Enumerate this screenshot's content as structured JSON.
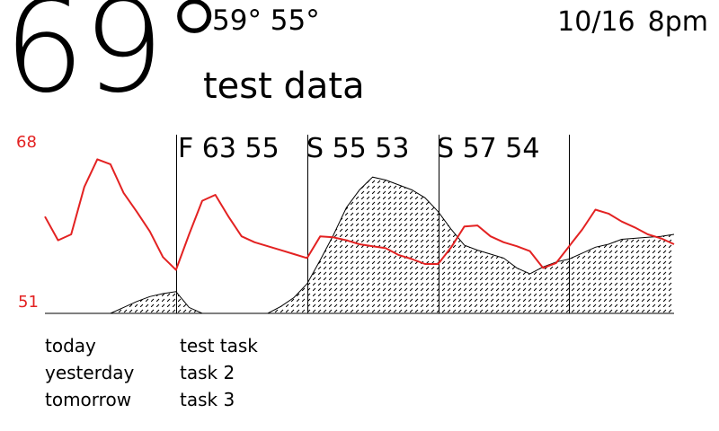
{
  "header": {
    "current_temp": "69°",
    "high_low": "59° 55°",
    "condition": "test data",
    "date": "10/16",
    "time": "8pm"
  },
  "chart_data": {
    "type": "line",
    "y_axis_labels": {
      "max": "68",
      "min": "51"
    },
    "ylim": [
      51,
      68
    ],
    "day_labels": [
      "F 63 55",
      "S 55 53",
      "S 57 54"
    ],
    "x": [
      0,
      1,
      2,
      3,
      4,
      5,
      6,
      7,
      8,
      9,
      10,
      11,
      12,
      13,
      14,
      15,
      16,
      17,
      18,
      19,
      20,
      21,
      22,
      23,
      24,
      25,
      26,
      27,
      28,
      29,
      30,
      31,
      32,
      33,
      34,
      35,
      36,
      37,
      38,
      39,
      40,
      41,
      42,
      43,
      44,
      45,
      46,
      47,
      48
    ],
    "day_boundaries": [
      10,
      20,
      30,
      40
    ],
    "series": [
      {
        "name": "",
        "style": "line",
        "color": "#e32222",
        "values": [
          60.8,
          58.4,
          59.0,
          63.8,
          66.6,
          66.1,
          63.2,
          61.3,
          59.3,
          56.7,
          55.4,
          59.0,
          62.4,
          63.0,
          60.8,
          58.8,
          58.2,
          57.8,
          57.4,
          57.0,
          56.6,
          58.8,
          58.7,
          58.4,
          58.0,
          57.8,
          57.6,
          56.9,
          56.5,
          56.0,
          56.0,
          57.7,
          59.8,
          59.9,
          58.8,
          58.2,
          57.8,
          57.3,
          55.6,
          56.1,
          57.8,
          59.5,
          61.5,
          61.1,
          60.3,
          59.7,
          59.0,
          58.6,
          58.0
        ]
      },
      {
        "name": "",
        "style": "hatched-area",
        "color": "#000000",
        "values": [
          51,
          51,
          51,
          51,
          51,
          51,
          51.6,
          52.2,
          52.7,
          53.0,
          53.2,
          51.6,
          51.0,
          51.0,
          51.0,
          51.0,
          51.0,
          51.0,
          51.7,
          52.6,
          54.0,
          56.4,
          58.9,
          61.7,
          63.5,
          64.8,
          64.5,
          64.0,
          63.5,
          62.7,
          61.3,
          59.5,
          57.9,
          57.4,
          57.0,
          56.6,
          55.6,
          55.0,
          55.7,
          56.2,
          56.5,
          57.1,
          57.7,
          58.0,
          58.5,
          58.6,
          58.7,
          58.8,
          59.0
        ]
      }
    ]
  },
  "lists": {
    "left": [
      "today",
      "yesterday",
      "tomorrow"
    ],
    "right": [
      "test task",
      "task 2",
      "task 3"
    ]
  }
}
